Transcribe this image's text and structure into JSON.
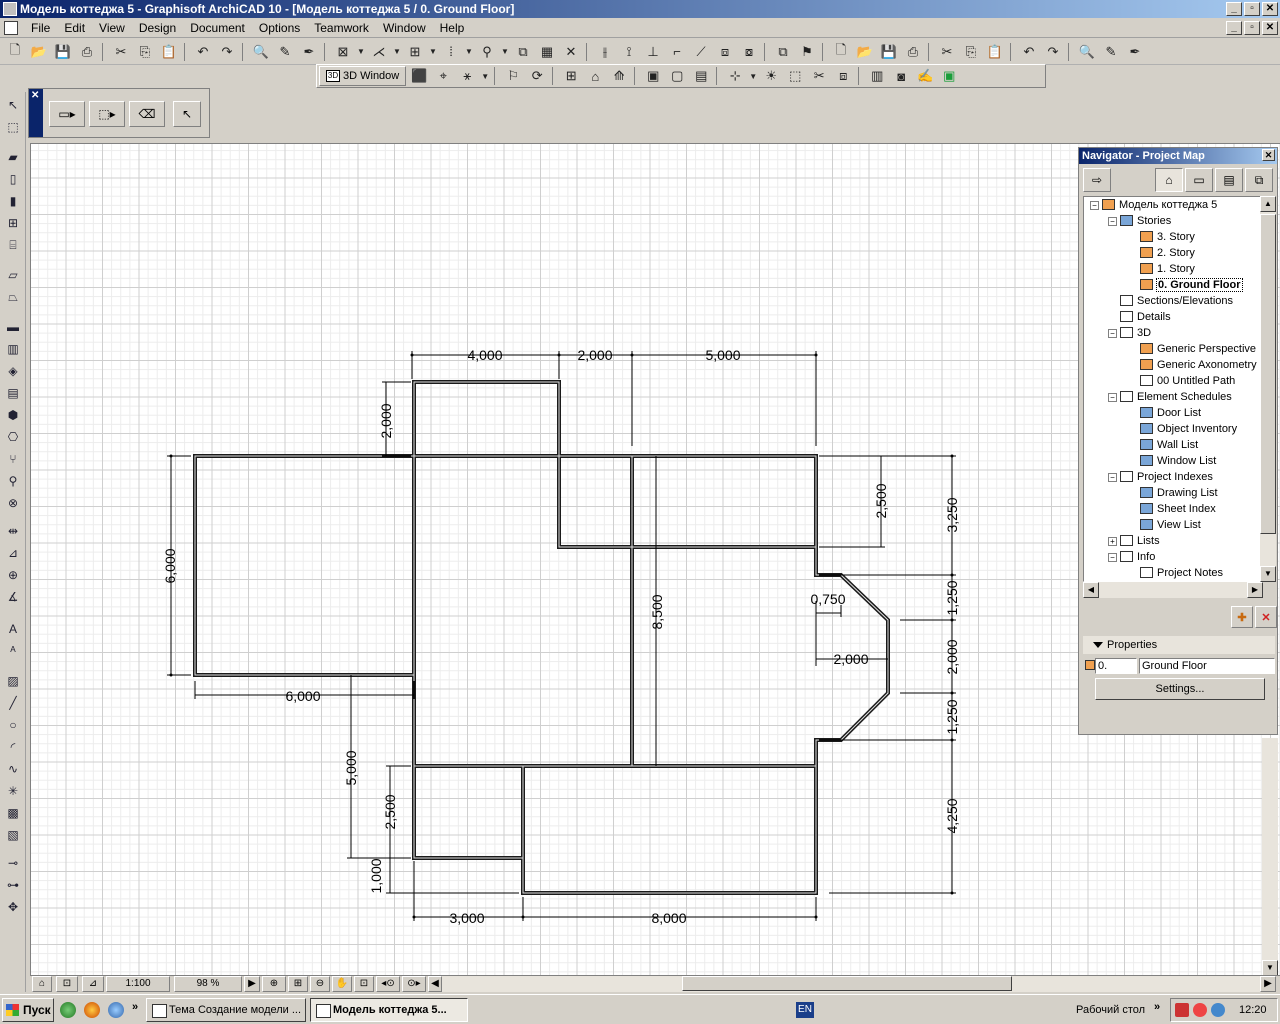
{
  "window": {
    "title": "Модель коттеджа 5 - Graphisoft ArchiCAD 10 - [Модель коттеджа 5 / 0. Ground Floor]",
    "controls": [
      "_",
      "▫",
      "✕"
    ],
    "doc_controls": [
      "_",
      "▫",
      "✕"
    ]
  },
  "menu": [
    "File",
    "Edit",
    "View",
    "Design",
    "Document",
    "Options",
    "Teamwork",
    "Window",
    "Help"
  ],
  "toolbar2": {
    "btn_3d_window": "3D Window"
  },
  "plan": {
    "dimensions": {
      "top_1": "4,000",
      "top_2": "2,000",
      "top_3": "5,000",
      "left_2000": "2,000",
      "left_6000": "6,000",
      "bottom_left_6000": "6,000",
      "left_5000": "5,000",
      "left_2500": "2,500",
      "left_1000": "1,000",
      "bottom_3000": "3,000",
      "bottom_8000": "8,000",
      "center_8500": "8,500",
      "right_2500": "2,500",
      "right_3250": "3,250",
      "right_1250a": "1,250",
      "right_2000": "2,000",
      "right_1250b": "1,250",
      "right_4250": "4,250",
      "bay_0750": "0,750",
      "bay_2000": "2,000"
    }
  },
  "navigator": {
    "title": "Navigator - Project Map",
    "tree": [
      {
        "label": "Модель коттеджа 5"
      },
      {
        "label": "Stories"
      },
      {
        "label": "3. Story"
      },
      {
        "label": "2. Story"
      },
      {
        "label": "1. Story"
      },
      {
        "label": "0. Ground Floor"
      },
      {
        "label": "Sections/Elevations"
      },
      {
        "label": "Details"
      },
      {
        "label": "3D"
      },
      {
        "label": "Generic Perspective"
      },
      {
        "label": "Generic Axonometry"
      },
      {
        "label": "00 Untitled Path"
      },
      {
        "label": "Element Schedules"
      },
      {
        "label": "Door List"
      },
      {
        "label": "Object Inventory"
      },
      {
        "label": "Wall List"
      },
      {
        "label": "Window List"
      },
      {
        "label": "Project Indexes"
      },
      {
        "label": "Drawing List"
      },
      {
        "label": "Sheet Index"
      },
      {
        "label": "View List"
      },
      {
        "label": "Lists"
      },
      {
        "label": "Info"
      },
      {
        "label": "Project Notes"
      }
    ],
    "properties_label": "Properties",
    "story_number": "0.",
    "story_name": "Ground Floor",
    "settings_button": "Settings..."
  },
  "statusbar": {
    "scale": "1:100",
    "zoom": "98 %"
  },
  "taskbar": {
    "start": "Пуск",
    "tasks": [
      "Тема Создание модели ...",
      "Модель коттеджа 5..."
    ],
    "language": "EN",
    "desktop_label": "Рабочий стол",
    "clock": "12:20"
  },
  "colors": {
    "title_start": "#0a246a",
    "title_end": "#a6caf0",
    "chrome": "#d4d0c8",
    "wall": "#1a1a1a"
  }
}
